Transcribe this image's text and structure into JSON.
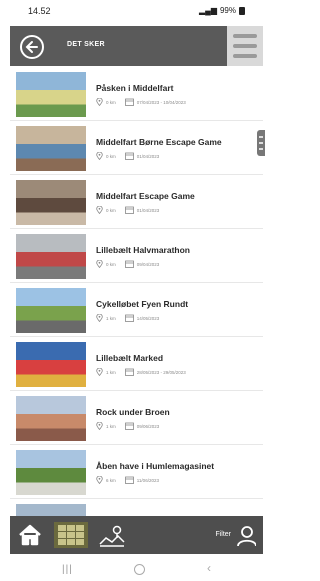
{
  "status_bar": {
    "time": "14.52",
    "battery": "99%"
  },
  "header": {
    "title": "DET SKER"
  },
  "events": [
    {
      "title": "Påsken i Middelfart",
      "distance": "0 km",
      "date": "07/04/2023 - 10/04/2023",
      "thumb_colors": [
        "#8fb6d8",
        "#d8d48a",
        "#6b9a4e"
      ]
    },
    {
      "title": "Middelfart Børne Escape Game",
      "distance": "0 km",
      "date": "01/04/2023",
      "thumb_colors": [
        "#c7b59c",
        "#5d88b0",
        "#8a6b55"
      ]
    },
    {
      "title": "Middelfart Escape Game",
      "distance": "0 km",
      "date": "01/04/2023",
      "thumb_colors": [
        "#9c8a78",
        "#5e4a3e",
        "#c9b9a6"
      ]
    },
    {
      "title": "Lillebælt Halvmarathon",
      "distance": "0 km",
      "date": "09/04/2023",
      "thumb_colors": [
        "#b8bcc0",
        "#c04848",
        "#7a7a7a"
      ]
    },
    {
      "title": "Cykelløbet Fyen Rundt",
      "distance": "1 km",
      "date": "14/05/2023",
      "thumb_colors": [
        "#9cc2e4",
        "#7aa24c",
        "#6a6a6a"
      ]
    },
    {
      "title": "Lillebælt Marked",
      "distance": "1 km",
      "date": "28/05/2023 - 29/05/2023",
      "thumb_colors": [
        "#3a6bb0",
        "#d84040",
        "#e0b040"
      ]
    },
    {
      "title": "Rock under Broen",
      "distance": "1 km",
      "date": "09/06/2023",
      "thumb_colors": [
        "#b8c8dc",
        "#c88a6a",
        "#8a5a4a"
      ]
    },
    {
      "title": "Åben have i Humlemagasinet",
      "distance": "6 km",
      "date": "11/06/2023",
      "thumb_colors": [
        "#a8c4e0",
        "#5e8a3e",
        "#d8d8d0"
      ]
    },
    {
      "title": "",
      "distance": "",
      "date": "",
      "thumb_colors": [
        "#a4b8cc",
        "#7a9a5a",
        "#888888"
      ]
    }
  ],
  "bottom_nav": {
    "filter_label": "Filter"
  },
  "colors": {
    "header_bg": "#5a5a5a",
    "nav_bg": "#4e4e4e",
    "grid_active": "#6b6a3e"
  }
}
